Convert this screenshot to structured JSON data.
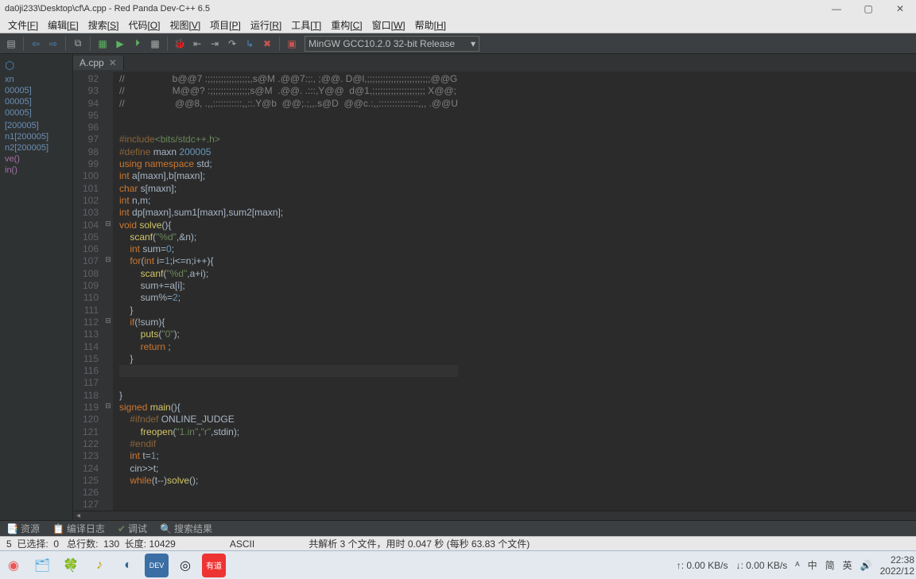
{
  "window": {
    "title": "da0ji233\\Desktop\\cf\\A.cpp - Red Panda Dev-C++ 6.5"
  },
  "menu": {
    "items": [
      {
        "label": "文件",
        "key": "F"
      },
      {
        "label": "编辑",
        "key": "E"
      },
      {
        "label": "搜索",
        "key": "S"
      },
      {
        "label": "代码",
        "key": "O"
      },
      {
        "label": "视图",
        "key": "V"
      },
      {
        "label": "项目",
        "key": "P"
      },
      {
        "label": "运行",
        "key": "R"
      },
      {
        "label": "工具",
        "key": "T"
      },
      {
        "label": "重构",
        "key": "C"
      },
      {
        "label": "窗口",
        "key": "W"
      },
      {
        "label": "帮助",
        "key": "H"
      }
    ]
  },
  "toolbar": {
    "compiler": "MinGW GCC10.2.0 32-bit Release"
  },
  "tab": {
    "name": "A.cpp"
  },
  "sidebar": {
    "items": [
      "xn",
      "00005]",
      "00005]",
      "00005]",
      "",
      "[200005]",
      "n1[200005]",
      "n2[200005]",
      "ve()",
      "in()"
    ]
  },
  "code": {
    "first_line": 92,
    "lines": [
      {
        "n": 92,
        "fold": "",
        "html": "<span class='cm'>//                  b@@7 :;;;;;;;;;;;;;;;;,s@M .@@7:;:, ;@@. D@l,;;;;;;;;;;;;;;;;;;;;;;;;@@G</span>"
      },
      {
        "n": 93,
        "fold": "",
        "html": "<span class='cm'>//                  M@@? :;;;;;;;;;;;;;;;s@M  .@@. .:::,Y@@  d@1,;;;;;;;;;;;;;;;;;;;; X@@;</span>"
      },
      {
        "n": 94,
        "fold": "",
        "html": "<span class='cm'>//                   @@8, .,,:::::::::::,,::.Y@b  @@;.;,,.s@D  @@c.:,,:::::::::::::::,,, .@@U</span>"
      },
      {
        "n": 95,
        "fold": "",
        "html": ""
      },
      {
        "n": 96,
        "fold": "",
        "html": ""
      },
      {
        "n": 97,
        "fold": "",
        "html": "<span class='pp'>#include</span><span class='str'>&lt;bits/stdc++.h&gt;</span>"
      },
      {
        "n": 98,
        "fold": "",
        "html": "<span class='pp'>#define</span> <span class='tp'>maxn</span> <span class='num'>200005</span>"
      },
      {
        "n": 99,
        "fold": "",
        "html": "<span class='kw'>using</span> <span class='kw'>namespace</span> std;"
      },
      {
        "n": 100,
        "fold": "",
        "html": "<span class='kw'>int</span> a[<span class='tp'>maxn</span>],b[<span class='tp'>maxn</span>];"
      },
      {
        "n": 101,
        "fold": "",
        "html": "<span class='kw'>char</span> s[<span class='tp'>maxn</span>];"
      },
      {
        "n": 102,
        "fold": "",
        "html": "<span class='kw'>int</span> n,m;"
      },
      {
        "n": 103,
        "fold": "",
        "html": "<span class='kw'>int</span> dp[<span class='tp'>maxn</span>],sum1[<span class='tp'>maxn</span>],sum2[<span class='tp'>maxn</span>];"
      },
      {
        "n": 104,
        "fold": "⊟",
        "html": "<span class='kw'>void</span> <span class='fn'>solve</span>(){"
      },
      {
        "n": 105,
        "fold": "",
        "html": "    <span class='fn'>scanf</span>(<span class='str'>\"%d\"</span>,&amp;n);"
      },
      {
        "n": 106,
        "fold": "",
        "html": "    <span class='kw'>int</span> sum=<span class='num'>0</span>;"
      },
      {
        "n": 107,
        "fold": "⊟",
        "html": "    <span class='kw'>for</span>(<span class='kw'>int</span> i=<span class='num'>1</span>;i&lt;=n;i++){"
      },
      {
        "n": 108,
        "fold": "",
        "html": "        <span class='fn'>scanf</span>(<span class='str'>\"%d\"</span>,a+i);"
      },
      {
        "n": 109,
        "fold": "",
        "html": "        sum+=a[i];"
      },
      {
        "n": 110,
        "fold": "",
        "html": "        sum%=<span class='num'>2</span>;"
      },
      {
        "n": 111,
        "fold": "",
        "html": "    }"
      },
      {
        "n": 112,
        "fold": "⊟",
        "html": "    <span class='kw'>if</span>(!sum){"
      },
      {
        "n": 113,
        "fold": "",
        "html": "        <span class='fn'>puts</span>(<span class='str'>\"0\"</span>);"
      },
      {
        "n": 114,
        "fold": "",
        "html": "        <span class='kw'>return</span> ;"
      },
      {
        "n": 115,
        "fold": "",
        "html": "    }"
      },
      {
        "n": 116,
        "fold": "",
        "html": "    ",
        "current": true
      },
      {
        "n": 117,
        "fold": "",
        "html": ""
      },
      {
        "n": 118,
        "fold": "",
        "html": "}"
      },
      {
        "n": 119,
        "fold": "⊟",
        "html": "<span class='kw'>signed</span> <span class='fn'>main</span>(){"
      },
      {
        "n": 120,
        "fold": "",
        "html": "    <span class='pp'>#ifndef</span> ONLINE_JUDGE"
      },
      {
        "n": 121,
        "fold": "",
        "html": "        <span class='fn'>freopen</span>(<span class='str'>\"1.in\"</span>,<span class='str'>\"r\"</span>,<span class='tp'>stdin</span>);"
      },
      {
        "n": 122,
        "fold": "",
        "html": "    <span class='pp'>#endif</span>"
      },
      {
        "n": 123,
        "fold": "",
        "html": "    <span class='kw'>int</span> t=<span class='num'>1</span>;"
      },
      {
        "n": 124,
        "fold": "",
        "html": "    cin&gt;&gt;t;"
      },
      {
        "n": 125,
        "fold": "",
        "html": "    <span class='kw'>while</span>(t--)<span class='fn'>solve</span>();"
      },
      {
        "n": 126,
        "fold": "",
        "html": ""
      },
      {
        "n": 127,
        "fold": "",
        "html": ""
      }
    ]
  },
  "bottom_tabs": {
    "res": "资源",
    "log": "编译日志",
    "dbg": "调试",
    "find": "搜索结果"
  },
  "status": {
    "sel_label": "已选择:",
    "sel": "0",
    "total_label": "总行数:",
    "total": "130",
    "len_label": "长度:",
    "len": "10429",
    "encoding": "ASCII",
    "parse": "共解析 3 个文件，用时 0.047 秒 (每秒 63.83 个文件)",
    "line_prefix": "5"
  },
  "tray": {
    "net_up": "↑: 0.00 KB/s",
    "net_dn": "↓: 0.00 KB/s",
    "ime1": "中",
    "ime2": "简",
    "ime3": "英",
    "time": "22:38",
    "date": "2022/12"
  }
}
